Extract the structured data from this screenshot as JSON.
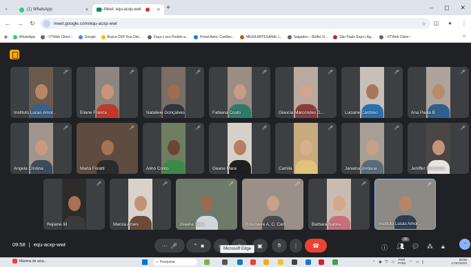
{
  "browser": {
    "tabs": [
      {
        "title": "(1) WhatsApp",
        "active": false
      },
      {
        "title": "Meet: equ-acxp-wwt",
        "active": true
      }
    ],
    "url": "meet.google.com/equ-acxp-wwt",
    "bookmarks": [
      {
        "label": "WhatsApp",
        "color": "#25d366"
      },
      {
        "label": "::VTWeb Client ::",
        "color": "#5f6368"
      },
      {
        "label": "Google",
        "color": "#4285f4"
      },
      {
        "label": "Busca CEP Rua Dist...",
        "color": "#fbbc04"
      },
      {
        "label": "Faça o seu Pedido a...",
        "color": "#5f6368"
      },
      {
        "label": "Portal Aleto: Cartões...",
        "color": "#1a73e8"
      },
      {
        "label": "MEGA ARTESANAL |...",
        "color": "#b06000"
      },
      {
        "label": "Salgados – Buffet Vi...",
        "color": "#5f6368"
      },
      {
        "label": "São Paulo Expo | Ag...",
        "color": "#c5221f"
      },
      {
        "label": "::VTWeb Client ::",
        "color": "#5f6368"
      }
    ]
  },
  "participants": [
    {
      "name": "Instituto Lucas Amor...",
      "bg": "#6b5b4e",
      "skin": "#b88666",
      "shirt": "#3b5f86"
    },
    {
      "name": "Eliane Franca",
      "bg": "#8c8580",
      "skin": "#c9957a",
      "shirt": "#c0392b"
    },
    {
      "name": "Natalieie Gonçalves",
      "bg": "#7a6e66",
      "skin": "#a06b50",
      "shirt": "#2e3540"
    },
    {
      "name": "Fabiana Couto",
      "bg": "#9a8d84",
      "skin": "#c89d85",
      "shirt": "#2f7a6a"
    },
    {
      "name": "Glaucia Marcondes D...",
      "bg": "#b9a99e",
      "skin": "#d1a590",
      "shirt": "#8c3b3b"
    },
    {
      "name": "Luciane Cardoso",
      "bg": "#c7bfb8",
      "skin": "#a7775c",
      "shirt": "#2b6fae"
    },
    {
      "name": "Ana Paula B",
      "bg": "#aea49c",
      "skin": "#b98a6c",
      "shirt": "#2f5f8a"
    },
    {
      "name": "Angela Cristina",
      "bg": "#a1968c",
      "skin": "#c99a80",
      "shirt": "#3d4a5a"
    },
    {
      "name": "Marta Foratti",
      "bg": "#5d4c3f",
      "skin": "#a47456",
      "shirt": "#2b2b2b"
    },
    {
      "name": "Alino Conto",
      "bg": "#6f7d62",
      "skin": "#6b4634",
      "shirt": "#3c8a4a"
    },
    {
      "name": "Geane Mara",
      "bg": "#d6d0c9",
      "skin": "#b47f63",
      "shirt": "#1f1f1f"
    },
    {
      "name": "Camila",
      "bg": "#c7aa7e",
      "skin": "#d9b08f",
      "shirt": "#e0c27a"
    },
    {
      "name": "Janaina Jordana",
      "bg": "#a89f94",
      "skin": "#c8a08a",
      "shirt": "#5a6b7b"
    },
    {
      "name": "Jeniffer Fernanda",
      "bg": "#4a4644",
      "skin": "#c49479",
      "shirt": "#e8e4e0"
    },
    {
      "name": "Rejiane Iiil",
      "bg": "#2d2b2a",
      "skin": "#a87056",
      "shirt": "#3a3a3a"
    },
    {
      "name": "Marcia Aroes",
      "bg": "#d8d2cb",
      "skin": "#c39176",
      "shirt": "#6b4a3a"
    },
    {
      "name": "Jislaine Silva",
      "bg": "#6e7a6a",
      "skin": "#9c6a50",
      "shirt": "#d3d7da"
    },
    {
      "name": "Rosimeire A. C. Cam...",
      "bg": "#9a9088",
      "skin": "#c9a08a",
      "shirt": "#4a4a4a"
    },
    {
      "name": "Barbara Nabila",
      "bg": "#c9bbb0",
      "skin": "#d4a888",
      "shirt": "#c9707a"
    },
    {
      "name": "Instituto Lucas Amor...",
      "bg": "#8d8a86",
      "skin": "#b88666",
      "shirt": "#2d3e52"
    }
  ],
  "meeting": {
    "time": "09:58",
    "code": "equ-acxp-wwt",
    "tooltip": "Microsoft Edge",
    "people_count": "20"
  },
  "taskbar": {
    "weather": "Máxima de ama...",
    "search_placeholder": "Pesquisar",
    "lang": "POR",
    "lang_sub": "PTB2",
    "time": "09:58",
    "date": "17/07/2024"
  }
}
